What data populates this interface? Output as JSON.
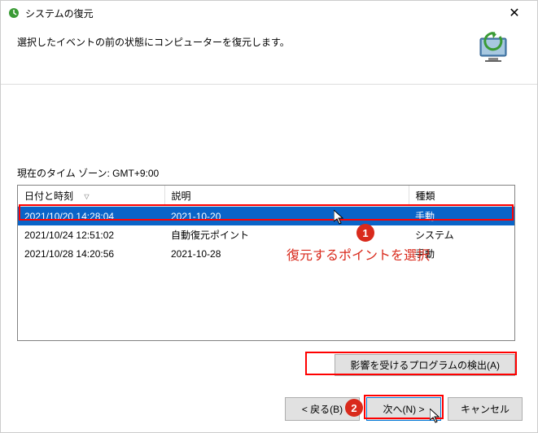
{
  "window": {
    "title": "システムの復元",
    "close": "✕"
  },
  "header": {
    "text": "選択したイベントの前の状態にコンピューターを復元します。"
  },
  "timezone_label": "現在のタイム ゾーン: GMT+9:00",
  "table": {
    "headers": {
      "date": "日付と時刻",
      "desc": "説明",
      "type": "種類"
    },
    "rows": [
      {
        "date": "2021/10/20 14:28:04",
        "desc": "2021-10-20",
        "type": "手動",
        "selected": true
      },
      {
        "date": "2021/10/24 12:51:02",
        "desc": "自動復元ポイント",
        "type": "システム",
        "selected": false
      },
      {
        "date": "2021/10/28 14:20:56",
        "desc": "2021-10-28",
        "type": "手動",
        "selected": false
      }
    ]
  },
  "buttons": {
    "scan": "影響を受けるプログラムの検出(A)",
    "back": "< 戻る(B)",
    "next": "次へ(N) >",
    "cancel": "キャンセル"
  },
  "annotations": {
    "badge1": "1",
    "badge2": "2",
    "hint": "復元するポイントを選択"
  }
}
